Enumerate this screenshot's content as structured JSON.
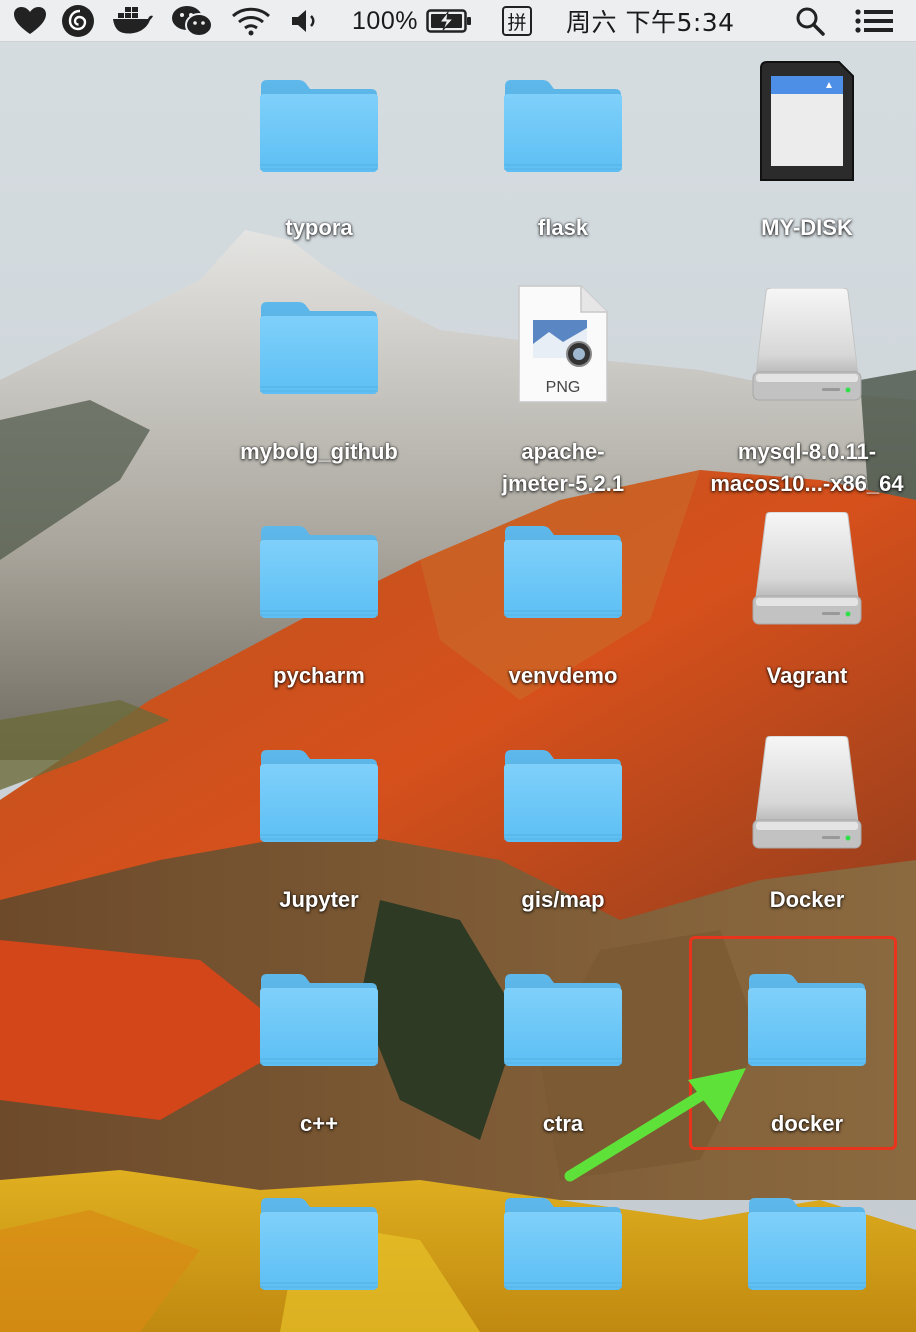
{
  "menubar": {
    "battery_percent": "100%",
    "input_method": "拼",
    "clock": "周六 下午5:34",
    "icons": [
      "heart-icon",
      "netease-music-icon",
      "docker-whale-icon",
      "wechat-icon",
      "wifi-icon",
      "volume-icon",
      "battery-charging-icon",
      "search-icon",
      "notification-list-icon"
    ]
  },
  "desktop": {
    "items": [
      {
        "name": "typora",
        "kind": "folder"
      },
      {
        "name": "flask",
        "kind": "folder"
      },
      {
        "name": "MY-DISK",
        "kind": "sd-card"
      },
      {
        "name": "mybolg_github",
        "kind": "folder"
      },
      {
        "name": "apache-jmeter-5.2.1",
        "line1": "apache-",
        "line2": "jmeter-5.2.1",
        "kind": "png-file",
        "badge": "PNG"
      },
      {
        "name": "mysql-8.0.11-macos10...-x86_64",
        "line1": "mysql-8.0.11-",
        "line2": "macos10...-x86_64",
        "kind": "disk"
      },
      {
        "name": "pycharm",
        "kind": "folder"
      },
      {
        "name": "venvdemo",
        "kind": "folder"
      },
      {
        "name": "Vagrant",
        "kind": "disk"
      },
      {
        "name": "Jupyter",
        "kind": "folder"
      },
      {
        "name": "gis/map",
        "kind": "folder"
      },
      {
        "name": "Docker",
        "kind": "disk"
      },
      {
        "name": "c++",
        "kind": "folder"
      },
      {
        "name": "ctra",
        "kind": "folder"
      },
      {
        "name": "docker",
        "kind": "folder",
        "highlighted": true
      },
      {
        "name": "",
        "kind": "folder"
      },
      {
        "name": "",
        "kind": "folder"
      },
      {
        "name": "",
        "kind": "folder"
      }
    ]
  },
  "annotation": {
    "highlight_color": "#e8331d",
    "arrow_color": "#5ee23a"
  }
}
